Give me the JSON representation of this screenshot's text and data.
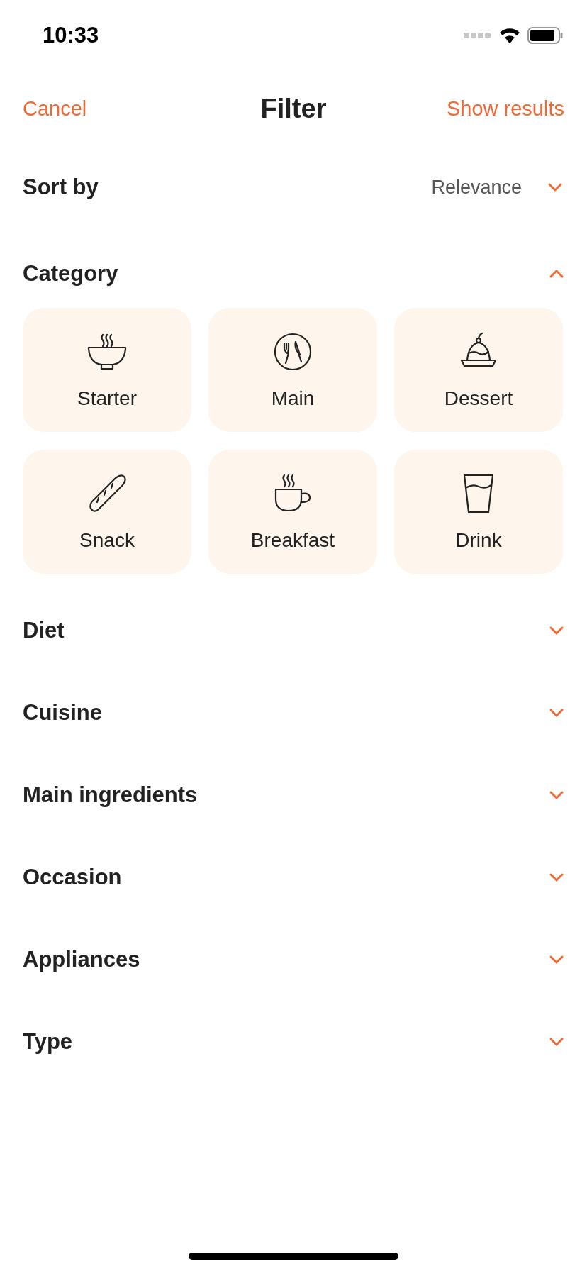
{
  "status_bar": {
    "time": "10:33"
  },
  "nav": {
    "cancel": "Cancel",
    "title": "Filter",
    "confirm": "Show results"
  },
  "sort": {
    "label": "Sort by",
    "value": "Relevance"
  },
  "category": {
    "label": "Category",
    "expanded": true,
    "tiles": [
      {
        "label": "Starter"
      },
      {
        "label": "Main"
      },
      {
        "label": "Dessert"
      },
      {
        "label": "Snack"
      },
      {
        "label": "Breakfast"
      },
      {
        "label": "Drink"
      }
    ]
  },
  "sections": [
    {
      "label": "Diet",
      "expanded": false
    },
    {
      "label": "Cuisine",
      "expanded": false
    },
    {
      "label": "Main ingredients",
      "expanded": false
    },
    {
      "label": "Occasion",
      "expanded": false
    },
    {
      "label": "Appliances",
      "expanded": false
    },
    {
      "label": "Type",
      "expanded": false
    }
  ]
}
